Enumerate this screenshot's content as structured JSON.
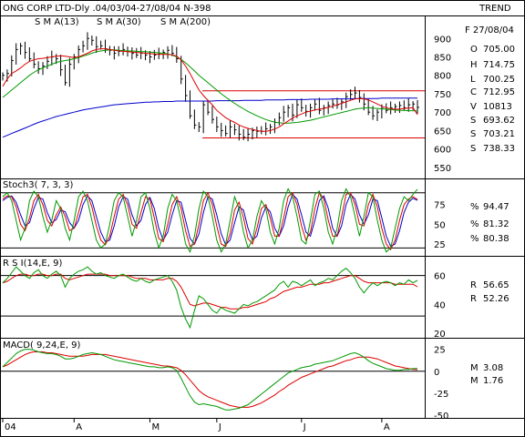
{
  "header": {
    "title": "ONG CORP LTD-Dly .04/03/04-27/08/04  N-398",
    "trend": "TREND",
    "date": "F 27/08/04"
  },
  "colors": {
    "sma13": "#dd0000",
    "sma30": "#009900",
    "sma200": "#0000cc",
    "price": "#000000",
    "stoch_k": "#009900",
    "stoch_d": "#dd0000",
    "stoch_slow": "#0000cc"
  },
  "chart_data": [
    {
      "type": "line",
      "panel": "price",
      "legend": [
        "S M A(13)",
        "S M A(30)",
        "S M A(200)"
      ],
      "ylim": [
        520,
        960
      ],
      "yticks": [
        "900",
        "850",
        "800",
        "750",
        "700",
        "650",
        "600",
        "550"
      ],
      "ytick_values": [
        900,
        850,
        800,
        750,
        700,
        650,
        600,
        550
      ],
      "close": [
        800,
        805,
        840,
        870,
        880,
        862,
        845,
        830,
        818,
        825,
        838,
        850,
        845,
        815,
        780,
        830,
        850,
        870,
        880,
        900,
        895,
        878,
        880,
        872,
        868,
        860,
        865,
        870,
        865,
        860,
        855,
        860,
        855,
        850,
        855,
        858,
        862,
        868,
        860,
        845,
        790,
        745,
        690,
        665,
        660,
        720,
        700,
        680,
        660,
        650,
        642,
        660,
        652,
        640,
        632,
        640,
        650,
        648,
        648,
        655,
        660,
        672,
        685,
        700,
        712,
        692,
        720,
        712,
        702,
        712,
        722,
        705,
        712,
        718,
        722,
        720,
        728,
        742,
        748,
        752,
        740,
        722,
        700,
        690,
        700,
        710,
        705,
        712,
        715,
        718,
        712,
        720,
        722,
        712.95
      ],
      "sma13": [
        770,
        790,
        805,
        812,
        820,
        830,
        838,
        842,
        845,
        846,
        848,
        850,
        852,
        853,
        852,
        850,
        848,
        850,
        855,
        860,
        866,
        870,
        872,
        872,
        870,
        868,
        866,
        865,
        864,
        863,
        862,
        861,
        860,
        859,
        858,
        857,
        857,
        857,
        856,
        852,
        842,
        825,
        805,
        782,
        760,
        745,
        732,
        720,
        705,
        695,
        685,
        678,
        672,
        665,
        660,
        656,
        653,
        650,
        648,
        648,
        650,
        654,
        660,
        668,
        676,
        684,
        690,
        695,
        700,
        703,
        706,
        708,
        710,
        713,
        716,
        720,
        724,
        728,
        732,
        736,
        737,
        736,
        733,
        728,
        722,
        716,
        712,
        709,
        708,
        708,
        710,
        711,
        712,
        693.62
      ],
      "sma30": [
        740,
        750,
        760,
        770,
        780,
        790,
        800,
        808,
        815,
        820,
        825,
        830,
        835,
        838,
        840,
        842,
        845,
        848,
        852,
        856,
        860,
        864,
        866,
        868,
        869,
        869,
        868,
        867,
        866,
        866,
        865,
        864,
        864,
        863,
        862,
        861,
        860,
        858,
        855,
        850,
        843,
        834,
        823,
        812,
        800,
        790,
        780,
        770,
        760,
        750,
        741,
        732,
        724,
        716,
        709,
        702,
        696,
        690,
        685,
        680,
        676,
        673,
        671,
        670,
        670,
        671,
        672,
        674,
        676,
        678,
        681,
        684,
        687,
        690,
        693,
        696,
        699,
        702,
        705,
        708,
        710,
        711,
        712,
        711,
        710,
        709,
        708,
        707,
        706,
        705,
        705,
        704,
        704,
        703.21
      ],
      "sma200": [
        632,
        637,
        642,
        647,
        652,
        657,
        662,
        667,
        672,
        676,
        680,
        684,
        688,
        691,
        694,
        697,
        700,
        703,
        706,
        708,
        710,
        712,
        714,
        716,
        718,
        720,
        721,
        722,
        723,
        724,
        725,
        726,
        727,
        727,
        728,
        728,
        729,
        729,
        729,
        730,
        730,
        730,
        730,
        730,
        730,
        730,
        730,
        730,
        731,
        731,
        731,
        731,
        731,
        731,
        732,
        732,
        732,
        732,
        732,
        733,
        733,
        733,
        733,
        733,
        734,
        734,
        734,
        734,
        734,
        735,
        735,
        735,
        735,
        735,
        736,
        736,
        736,
        736,
        736,
        737,
        737,
        737,
        737,
        737,
        737,
        738,
        738,
        738,
        738,
        738,
        738,
        738,
        738,
        738.33
      ],
      "horizontal_lines": [
        758,
        630
      ],
      "readout": [
        {
          "label": "O",
          "value": "705.00",
          "color": "#000000"
        },
        {
          "label": "H",
          "value": "714.75",
          "color": "#999900"
        },
        {
          "label": "L",
          "value": "700.25",
          "color": "#999900"
        },
        {
          "label": "C",
          "value": "712.95",
          "color": "#999900"
        },
        {
          "label": "V",
          "value": "10813",
          "color": "#000000"
        },
        {
          "label": "S",
          "value": "693.62",
          "color": "#dd0000"
        },
        {
          "label": "S",
          "value": "703.21",
          "color": "#009900"
        },
        {
          "label": "S",
          "value": "738.33",
          "color": "#0000cc"
        }
      ]
    },
    {
      "type": "line",
      "panel": "stoch",
      "title": "Stoch3( 7, 3, 3)",
      "ylim": [
        10,
        107
      ],
      "yticks": [
        "75",
        "50",
        "25"
      ],
      "ytick_values": [
        75,
        50,
        25
      ],
      "horizontal_lines": [
        90,
        20
      ],
      "k": [
        85,
        90,
        80,
        55,
        30,
        45,
        80,
        92,
        85,
        60,
        40,
        55,
        80,
        70,
        45,
        30,
        55,
        85,
        92,
        80,
        55,
        30,
        20,
        25,
        50,
        80,
        90,
        85,
        60,
        35,
        55,
        85,
        90,
        70,
        40,
        20,
        35,
        70,
        88,
        80,
        55,
        25,
        15,
        35,
        70,
        92,
        85,
        60,
        30,
        15,
        25,
        55,
        85,
        70,
        40,
        20,
        30,
        60,
        80,
        70,
        40,
        25,
        45,
        80,
        95,
        85,
        60,
        30,
        25,
        55,
        88,
        92,
        70,
        40,
        25,
        45,
        80,
        95,
        85,
        60,
        35,
        60,
        90,
        85,
        55,
        30,
        15,
        20,
        45,
        70,
        85,
        80,
        88,
        94.47
      ],
      "d": [
        82,
        86,
        85,
        72,
        50,
        42,
        58,
        80,
        88,
        75,
        55,
        48,
        62,
        72,
        60,
        42,
        45,
        65,
        85,
        88,
        72,
        48,
        30,
        24,
        35,
        60,
        82,
        88,
        75,
        50,
        45,
        65,
        85,
        82,
        58,
        32,
        28,
        50,
        75,
        85,
        70,
        42,
        22,
        25,
        50,
        80,
        90,
        75,
        48,
        25,
        22,
        38,
        68,
        78,
        58,
        32,
        25,
        45,
        70,
        75,
        58,
        35,
        35,
        58,
        85,
        90,
        75,
        48,
        30,
        40,
        70,
        90,
        82,
        55,
        35,
        35,
        60,
        88,
        90,
        75,
        50,
        48,
        75,
        88,
        72,
        45,
        25,
        18,
        30,
        55,
        75,
        82,
        85,
        81.32
      ],
      "slow": [
        80,
        84,
        86,
        78,
        62,
        48,
        52,
        70,
        84,
        82,
        65,
        52,
        56,
        68,
        66,
        52,
        45,
        55,
        75,
        86,
        80,
        60,
        40,
        28,
        30,
        48,
        72,
        85,
        82,
        62,
        48,
        55,
        75,
        84,
        70,
        45,
        30,
        40,
        62,
        80,
        78,
        55,
        32,
        25,
        38,
        65,
        85,
        82,
        62,
        38,
        24,
        30,
        52,
        72,
        68,
        45,
        30,
        35,
        58,
        72,
        66,
        45,
        35,
        48,
        72,
        88,
        82,
        62,
        40,
        35,
        55,
        80,
        86,
        70,
        45,
        35,
        48,
        75,
        88,
        82,
        62,
        50,
        62,
        82,
        80,
        58,
        35,
        22,
        25,
        42,
        65,
        78,
        83,
        80.38
      ],
      "readout": [
        {
          "label": "%",
          "value": "94.47",
          "color": "#009900"
        },
        {
          "label": "%",
          "value": "81.32",
          "color": "#dd0000"
        },
        {
          "label": "%",
          "value": "80.38",
          "color": "#0000cc"
        }
      ]
    },
    {
      "type": "line",
      "panel": "rsi",
      "title": "R S I(14,E, 9)",
      "ylim": [
        17,
        73
      ],
      "yticks": [
        "60",
        "40",
        "20"
      ],
      "ytick_values": [
        60,
        40,
        20
      ],
      "horizontal_lines": [
        60,
        32
      ],
      "rsi": [
        55,
        58,
        62,
        66,
        63,
        60,
        58,
        62,
        64,
        60,
        58,
        61,
        63,
        60,
        52,
        58,
        61,
        63,
        64,
        66,
        63,
        61,
        62,
        60,
        59,
        58,
        60,
        61,
        59,
        57,
        56,
        58,
        56,
        55,
        57,
        58,
        59,
        60,
        56,
        50,
        38,
        30,
        24,
        36,
        46,
        44,
        40,
        36,
        34,
        38,
        36,
        35,
        34,
        37,
        40,
        39,
        41,
        42,
        44,
        46,
        48,
        50,
        54,
        56,
        52,
        56,
        55,
        53,
        55,
        57,
        53,
        55,
        56,
        58,
        57,
        60,
        63,
        65,
        62,
        58,
        52,
        48,
        52,
        55,
        53,
        55,
        56,
        55,
        53,
        55,
        54,
        57,
        55,
        56.65
      ],
      "signal": [
        55,
        56,
        58,
        60,
        61,
        61,
        60,
        60,
        61,
        61,
        60,
        60,
        61,
        61,
        58,
        57,
        58,
        59,
        60,
        61,
        61,
        61,
        61,
        61,
        60,
        60,
        60,
        60,
        60,
        59,
        58,
        58,
        58,
        57,
        57,
        57,
        57,
        58,
        58,
        56,
        52,
        46,
        40,
        39,
        40,
        41,
        41,
        40,
        39,
        38,
        38,
        37,
        37,
        37,
        38,
        38,
        39,
        40,
        41,
        42,
        44,
        45,
        47,
        49,
        50,
        51,
        52,
        52,
        53,
        54,
        54,
        54,
        55,
        55,
        56,
        57,
        58,
        59,
        60,
        60,
        58,
        56,
        55,
        55,
        55,
        55,
        55,
        55,
        54,
        54,
        54,
        54,
        54,
        52.26
      ],
      "readout": [
        {
          "label": "R",
          "value": "56.65",
          "color": "#009900"
        },
        {
          "label": "R",
          "value": "52.26",
          "color": "#dd0000"
        }
      ]
    },
    {
      "type": "line",
      "panel": "macd",
      "title": "MACD( 9,24,E, 9)",
      "ylim": [
        -53,
        37
      ],
      "yticks": [
        "25",
        "0",
        "-25",
        "-50"
      ],
      "ytick_values": [
        25,
        0,
        -25,
        -50
      ],
      "horizontal_lines": [
        0
      ],
      "macd": [
        5,
        10,
        15,
        20,
        23,
        25,
        25,
        24,
        22,
        21,
        20,
        20,
        19,
        17,
        14,
        14,
        15,
        17,
        19,
        20,
        21,
        20,
        19,
        17,
        15,
        13,
        12,
        11,
        10,
        9,
        8,
        7,
        6,
        5,
        5,
        4,
        4,
        5,
        4,
        1,
        -8,
        -18,
        -28,
        -35,
        -38,
        -37,
        -38,
        -39,
        -40,
        -42,
        -44,
        -44,
        -43,
        -42,
        -40,
        -38,
        -34,
        -30,
        -26,
        -22,
        -18,
        -14,
        -10,
        -6,
        -2,
        0,
        2,
        4,
        5,
        6,
        8,
        9,
        10,
        11,
        12,
        14,
        16,
        18,
        20,
        21,
        19,
        16,
        12,
        9,
        7,
        5,
        3,
        2,
        1,
        1,
        2,
        2,
        3,
        3.08
      ],
      "signal": [
        5,
        7,
        10,
        13,
        16,
        19,
        21,
        22,
        22,
        22,
        21,
        21,
        20,
        19,
        18,
        17,
        17,
        17,
        17,
        18,
        19,
        19,
        19,
        19,
        18,
        17,
        16,
        15,
        14,
        13,
        12,
        11,
        10,
        9,
        8,
        7,
        6,
        6,
        5,
        4,
        1,
        -4,
        -10,
        -16,
        -22,
        -26,
        -29,
        -31,
        -33,
        -35,
        -37,
        -39,
        -40,
        -41,
        -41,
        -41,
        -40,
        -38,
        -36,
        -33,
        -30,
        -27,
        -23,
        -20,
        -16,
        -13,
        -10,
        -7,
        -5,
        -3,
        -1,
        1,
        3,
        5,
        6,
        8,
        10,
        12,
        13,
        15,
        16,
        16,
        16,
        15,
        14,
        12,
        10,
        8,
        6,
        5,
        4,
        3,
        2,
        1.76
      ],
      "readout": [
        {
          "label": "M",
          "value": "3.08",
          "color": "#009900"
        },
        {
          "label": "M",
          "value": "1.76",
          "color": "#dd0000"
        }
      ]
    }
  ],
  "x_axis": {
    "labels": [
      "04",
      "A",
      "M",
      "J",
      "J",
      "A"
    ],
    "positions": [
      0,
      16,
      33,
      48,
      67,
      85
    ]
  }
}
